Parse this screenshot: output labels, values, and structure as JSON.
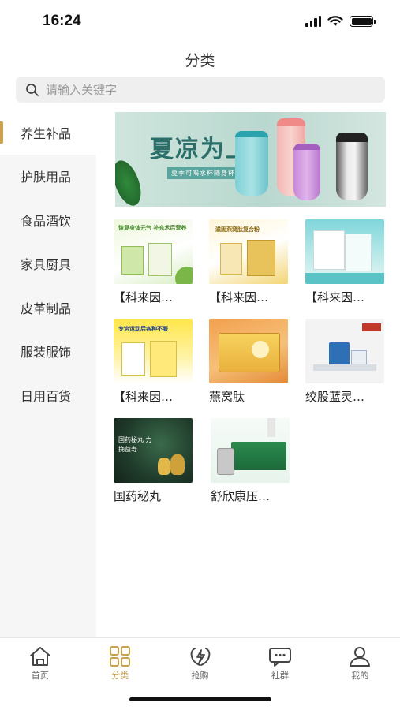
{
  "status_bar": {
    "time": "16:24"
  },
  "header": {
    "title": "分类"
  },
  "search": {
    "placeholder": "请输入关键字"
  },
  "sidebar": {
    "items": [
      {
        "label": "养生补品",
        "active": true
      },
      {
        "label": "护肤用品"
      },
      {
        "label": "食品酒饮"
      },
      {
        "label": "家具厨具"
      },
      {
        "label": "皮革制品"
      },
      {
        "label": "服装服饰"
      },
      {
        "label": "日用百货"
      }
    ]
  },
  "banner": {
    "title": "夏凉为上",
    "subtitle": "夏季可喝水杯随身杯"
  },
  "products": [
    {
      "name": "【科来因…",
      "thumb_label": "恢复身体元气 补充术后营养"
    },
    {
      "name": "【科来因…",
      "thumb_label": "滋固燕窝肽复合粉"
    },
    {
      "name": "【科来因…",
      "thumb_label": ""
    },
    {
      "name": "【科来因…",
      "thumb_label": "专治运动后各种不服"
    },
    {
      "name": "燕窝肽",
      "thumb_label": ""
    },
    {
      "name": "绞股蓝灵…",
      "thumb_label": ""
    },
    {
      "name": "国药秘丸",
      "thumb_label": "国药秘丸 力挽益寿"
    },
    {
      "name": "舒欣康压…",
      "thumb_label": ""
    }
  ],
  "tabbar": {
    "items": [
      {
        "label": "首页",
        "icon": "home-icon"
      },
      {
        "label": "分类",
        "icon": "category-icon",
        "active": true
      },
      {
        "label": "抢购",
        "icon": "flash-sale-icon"
      },
      {
        "label": "社群",
        "icon": "community-icon"
      },
      {
        "label": "我的",
        "icon": "profile-icon"
      }
    ]
  },
  "colors": {
    "accent": "#c9a14c",
    "sidebar_bg": "#f6f6f6",
    "search_bg": "#efefef"
  }
}
